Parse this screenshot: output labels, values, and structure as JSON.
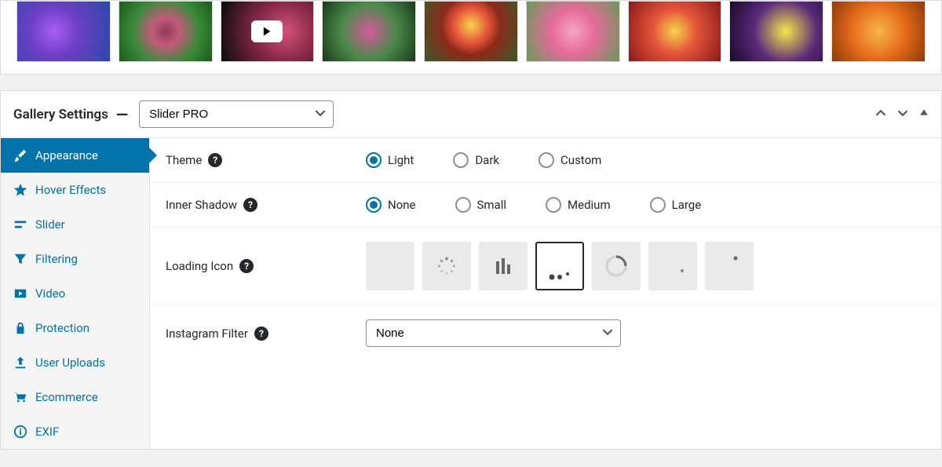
{
  "header": {
    "title": "Gallery Settings",
    "preset": "Slider PRO"
  },
  "sidebar": {
    "items": [
      {
        "label": "Appearance"
      },
      {
        "label": "Hover Effects"
      },
      {
        "label": "Slider"
      },
      {
        "label": "Filtering"
      },
      {
        "label": "Video"
      },
      {
        "label": "Protection"
      },
      {
        "label": "User Uploads"
      },
      {
        "label": "Ecommerce"
      },
      {
        "label": "EXIF"
      }
    ]
  },
  "form": {
    "theme": {
      "label": "Theme",
      "options": [
        "Light",
        "Dark",
        "Custom"
      ],
      "selected": "Light"
    },
    "inner_shadow": {
      "label": "Inner Shadow",
      "options": [
        "None",
        "Small",
        "Medium",
        "Large"
      ],
      "selected": "None"
    },
    "loading_icon": {
      "label": "Loading Icon"
    },
    "instagram_filter": {
      "label": "Instagram Filter",
      "selected": "None"
    }
  }
}
